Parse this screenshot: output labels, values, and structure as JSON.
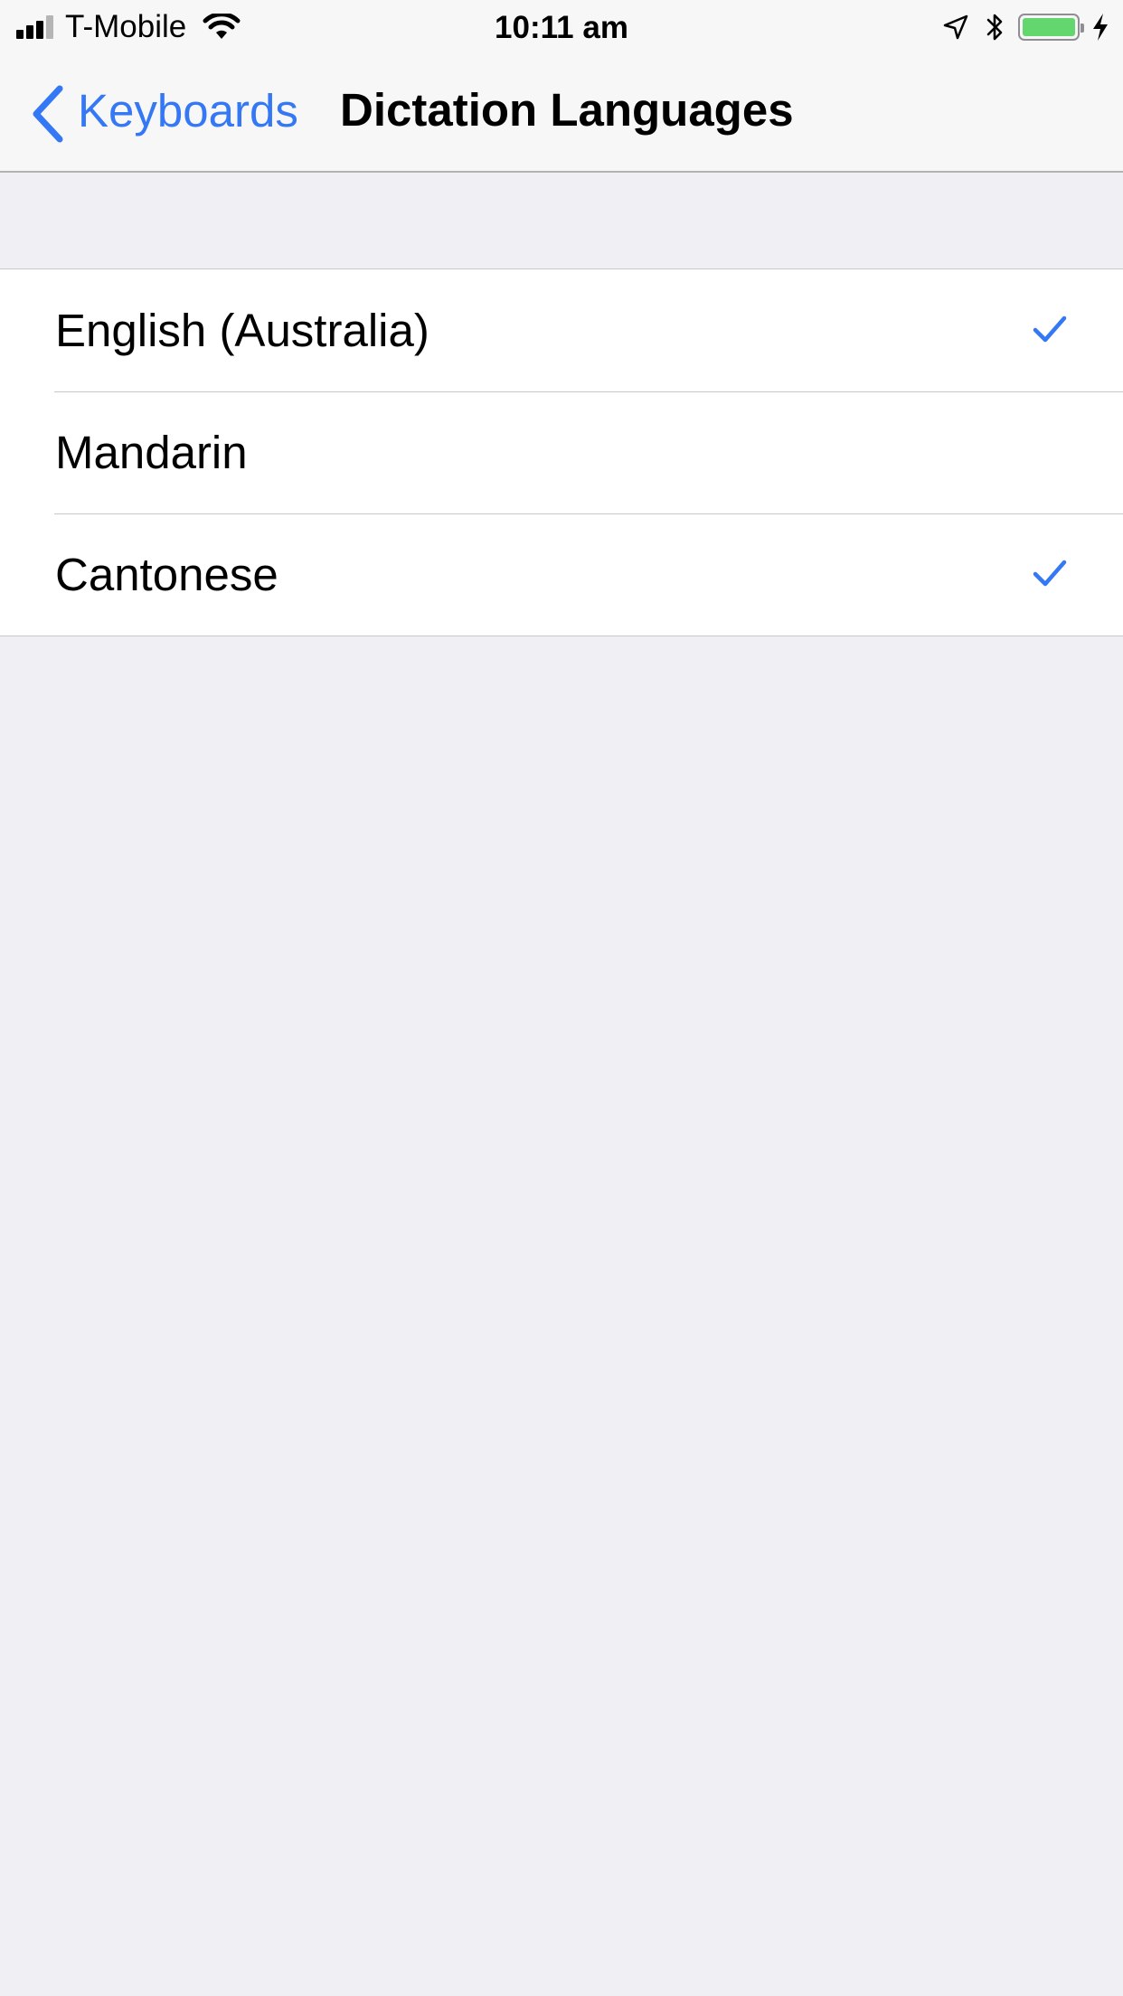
{
  "status_bar": {
    "carrier": "T-Mobile",
    "time": "10:11 am",
    "signal_bars_filled": 3,
    "signal_bars_total": 4,
    "battery_level": 1.0,
    "icons": [
      "signal-icon",
      "wifi-icon",
      "location-icon",
      "bluetooth-icon",
      "battery-icon",
      "charging-icon"
    ]
  },
  "nav": {
    "back_label": "Keyboards",
    "back_icon": "chevron-left-icon",
    "title": "Dictation Languages"
  },
  "languages": [
    {
      "label": "English (Australia)",
      "checked": true
    },
    {
      "label": "Mandarin",
      "checked": false
    },
    {
      "label": "Cantonese",
      "checked": true
    }
  ],
  "colors": {
    "accent": "#3478f6",
    "background": "#efeff4",
    "battery": "#63d66d"
  }
}
